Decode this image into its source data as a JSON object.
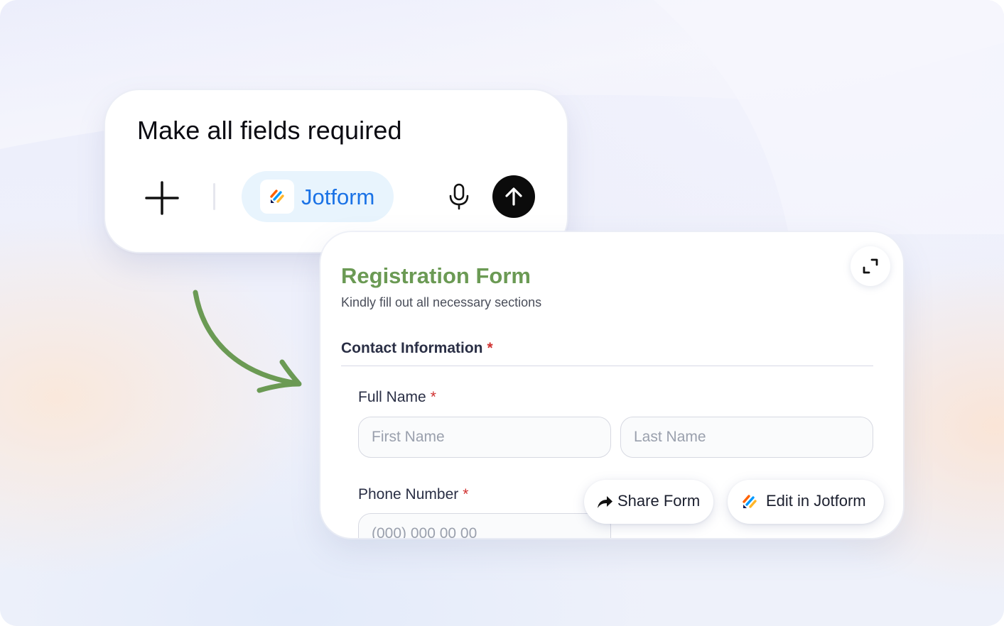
{
  "prompt": {
    "text": "Make all fields required",
    "chip_label": "Jotform",
    "icons": [
      "plus-icon",
      "jotform-logo-icon",
      "microphone-icon",
      "arrow-up-icon"
    ]
  },
  "form": {
    "title": "Registration Form",
    "subtitle": "Kindly fill out all necessary sections",
    "section_heading": "Contact Information",
    "required_mark": "*",
    "full_name_label": "Full Name",
    "first_name_placeholder": "First Name",
    "last_name_placeholder": "Last Name",
    "phone_label": "Phone Number",
    "phone_placeholder": "(000) 000 00 00",
    "share_label": "Share Form",
    "edit_label": "Edit in Jotform"
  },
  "colors": {
    "title_green": "#6b9a54",
    "required_red": "#d0302f",
    "chip_blue": "#1a72e6",
    "chip_bg": "#e8f4fd"
  }
}
